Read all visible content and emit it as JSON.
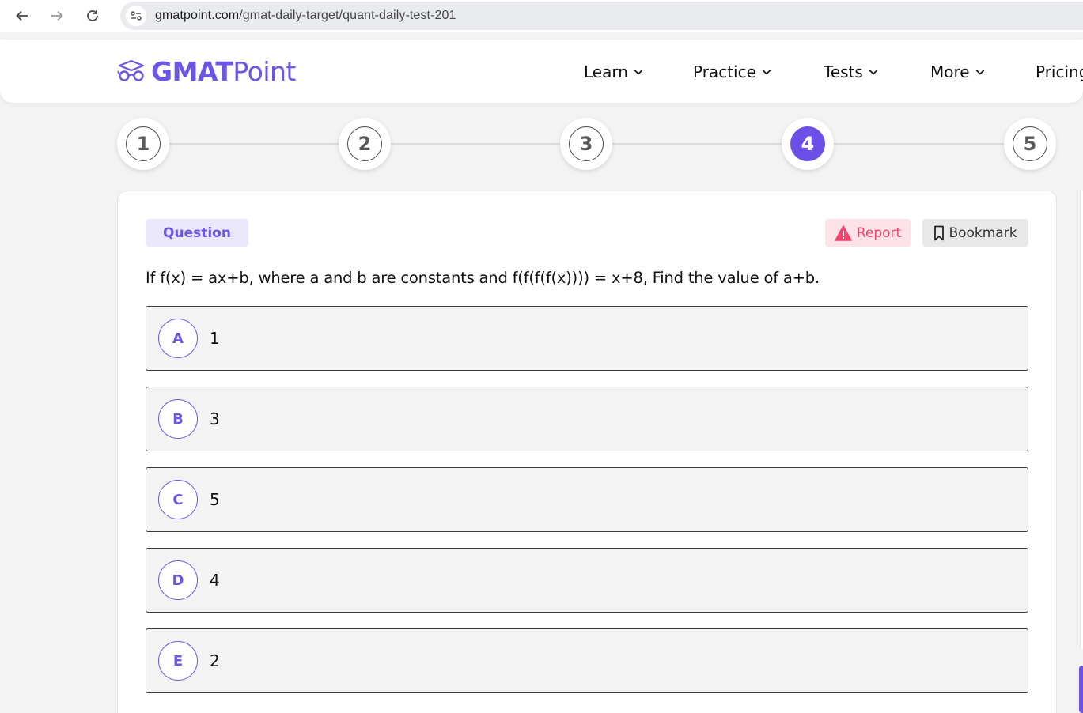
{
  "browser": {
    "url_domain": "gmatpoint.com",
    "url_path": "/gmat-daily-target/quant-daily-test-201"
  },
  "header": {
    "logo_bold": "GMAT",
    "logo_light": "Point",
    "nav": [
      {
        "label": "Learn"
      },
      {
        "label": "Practice"
      },
      {
        "label": "Tests"
      },
      {
        "label": "More"
      },
      {
        "label": "Pricing"
      }
    ]
  },
  "stepper": {
    "steps": [
      "1",
      "2",
      "3",
      "4",
      "5"
    ],
    "active_step": "4"
  },
  "question": {
    "badge": "Question",
    "report_label": "Report",
    "bookmark_label": "Bookmark",
    "text": "If f(x) = ax+b, where a and b are constants and f(f(f(f(x)))) = x+8, Find the value of a+b.",
    "options": [
      {
        "letter": "A",
        "value": "1"
      },
      {
        "letter": "B",
        "value": "3"
      },
      {
        "letter": "C",
        "value": "5"
      },
      {
        "letter": "D",
        "value": "4"
      },
      {
        "letter": "E",
        "value": "2"
      }
    ]
  },
  "colors": {
    "brand": "#6d56e6",
    "report": "#f0426a",
    "active_step": "#6c4fe6"
  },
  "icons": [
    "back-arrow-icon",
    "forward-arrow-icon",
    "reload-icon",
    "site-settings-icon",
    "graduation-glasses-icon",
    "chevron-down-icon",
    "warning-icon",
    "bookmark-icon"
  ]
}
